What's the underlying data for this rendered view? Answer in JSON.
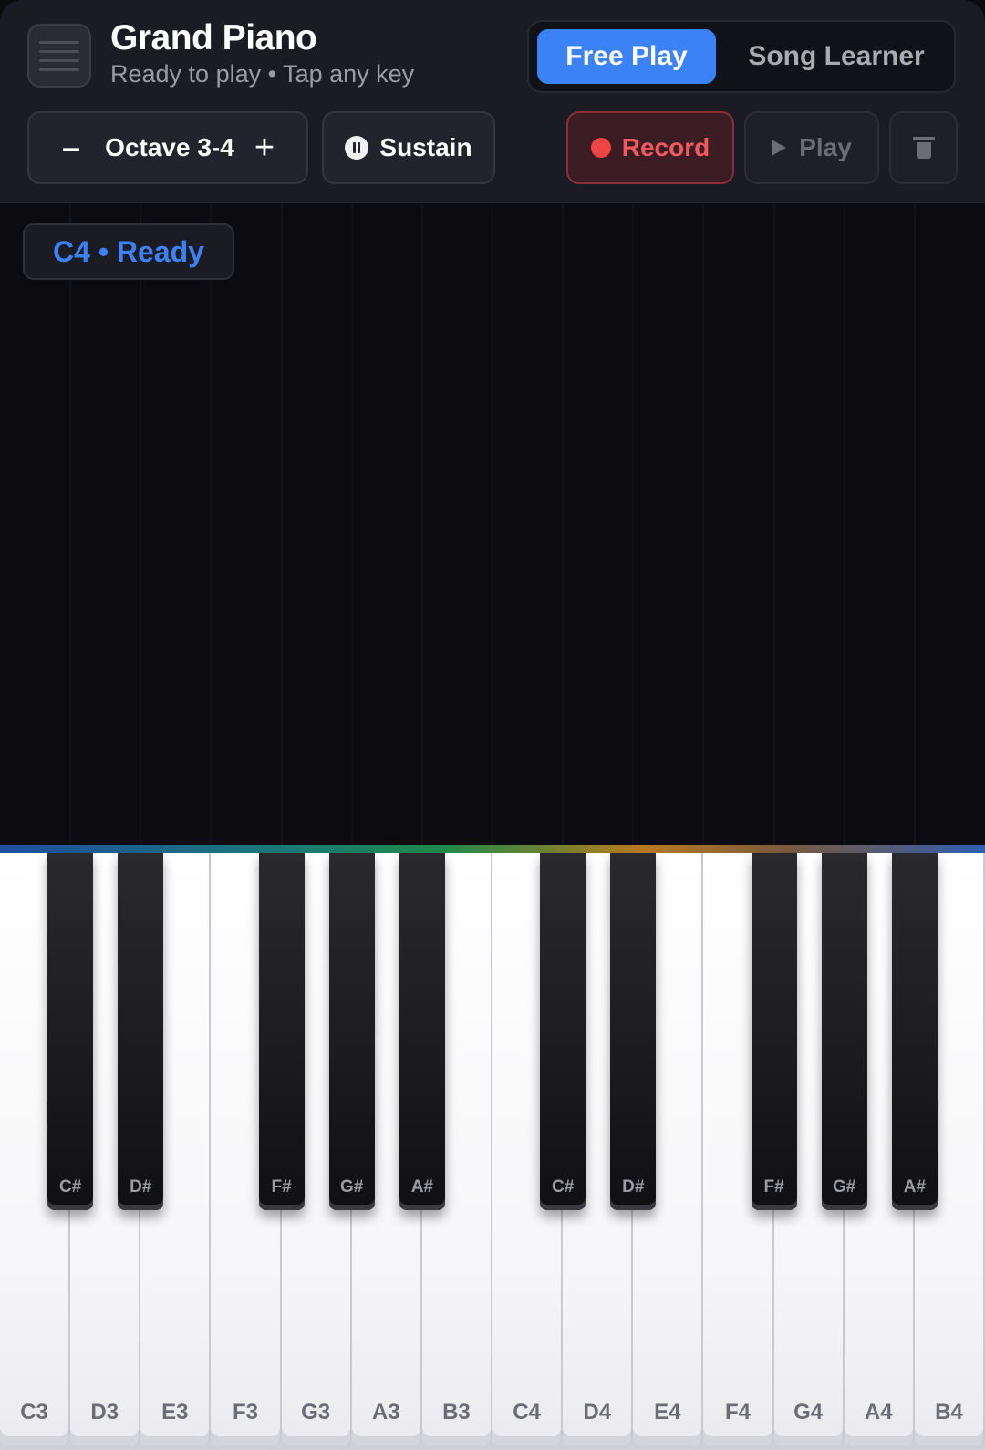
{
  "header": {
    "title": "Grand Piano",
    "subtitle": "Ready to play • Tap any key",
    "app_icon": "sheet-music-icon"
  },
  "modes": {
    "free_play": "Free Play",
    "song_learner": "Song Learner",
    "active": "Free Play"
  },
  "controls": {
    "octave_label": "Octave 3-4",
    "octave_minus": "–",
    "octave_plus": "+",
    "sustain": "Sustain",
    "record": "Record",
    "play": "Play"
  },
  "status": {
    "badge": "C4 • Ready"
  },
  "colors": {
    "accent": "#3b82f6",
    "record": "#ef4444",
    "background": "#0b0b10"
  },
  "keyboard": {
    "white_keys": [
      "C3",
      "D3",
      "E3",
      "F3",
      "G3",
      "A3",
      "B3",
      "C4",
      "D4",
      "E4",
      "F4",
      "G4",
      "A4",
      "B4"
    ],
    "black_keys": [
      "C#",
      "D#",
      "F#",
      "G#",
      "A#",
      "C#",
      "D#",
      "F#",
      "G#",
      "A#"
    ]
  }
}
